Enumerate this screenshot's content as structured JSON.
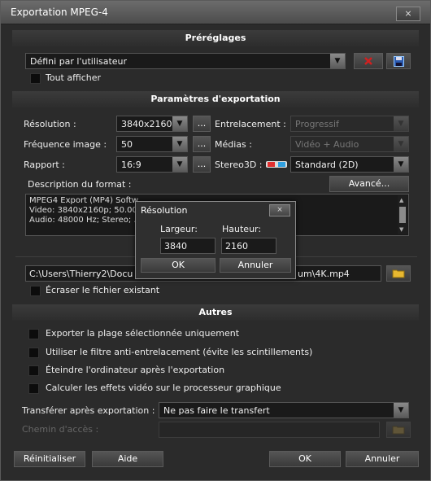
{
  "window": {
    "title": "Exportation MPEG-4",
    "close_label": "⨯"
  },
  "presets": {
    "header": "Préréglages",
    "selected": "Défini par l'utilisateur",
    "show_all_label": "Tout afficher"
  },
  "params": {
    "header": "Paramètres d'exportation",
    "resolution_label": "Résolution :",
    "resolution_value": "3840x2160",
    "framerate_label": "Fréquence image :",
    "framerate_value": "50",
    "ratio_label": "Rapport :",
    "ratio_value": "16:9",
    "more_label": "...",
    "interlace_label": "Entrelacement :",
    "interlace_value": "Progressif",
    "media_label": "Médias :",
    "media_value": "Vidéo + Audio",
    "stereo_label": "Stereo3D :",
    "stereo_value": "Standard (2D)",
    "desc_label": "Description du format :",
    "advanced_label": "Avancé...",
    "desc_lines": [
      "MPEG4 Export (MP4) Softw",
      "Video: 3840x2160p; 50.00",
      "Audio: 48000 Hz; Stereo; ."
    ]
  },
  "output": {
    "path": "C:\\Users\\Thierry2\\Docu",
    "path_end": "um\\4K.mp4",
    "overwrite_label": "Écraser le fichier existant"
  },
  "others": {
    "header": "Autres",
    "options": [
      "Exporter la plage sélectionnée uniquement",
      "Utiliser le filtre anti-entrelacement (évite les scintillements)",
      "Éteindre l'ordinateur après l'exportation",
      "Calculer les effets vidéo sur le processeur graphique"
    ],
    "transfer_label": "Transférer après exportation :",
    "transfer_value": "Ne pas faire le transfert",
    "access_label": "Chemin d'accès :"
  },
  "footer": {
    "reset": "Réinitialiser",
    "help": "Aide",
    "ok": "OK",
    "cancel": "Annuler"
  },
  "dialog": {
    "title": "Résolution",
    "close_label": "⨯",
    "width_label": "Largeur:",
    "height_label": "Hauteur:",
    "width_value": "3840",
    "height_value": "2160",
    "ok": "OK",
    "cancel": "Annuler"
  },
  "colors": {
    "window_bg": "#2b2b2b",
    "field_bg": "#1a1a1a",
    "delete_red": "#c82020",
    "save_blue": "#2a5ab0",
    "folder_yellow": "#e8b830"
  },
  "icons": [
    "close-icon",
    "delete-icon",
    "save-icon",
    "stereo-glasses-icon",
    "folder-icon",
    "chevron-down-icon"
  ]
}
